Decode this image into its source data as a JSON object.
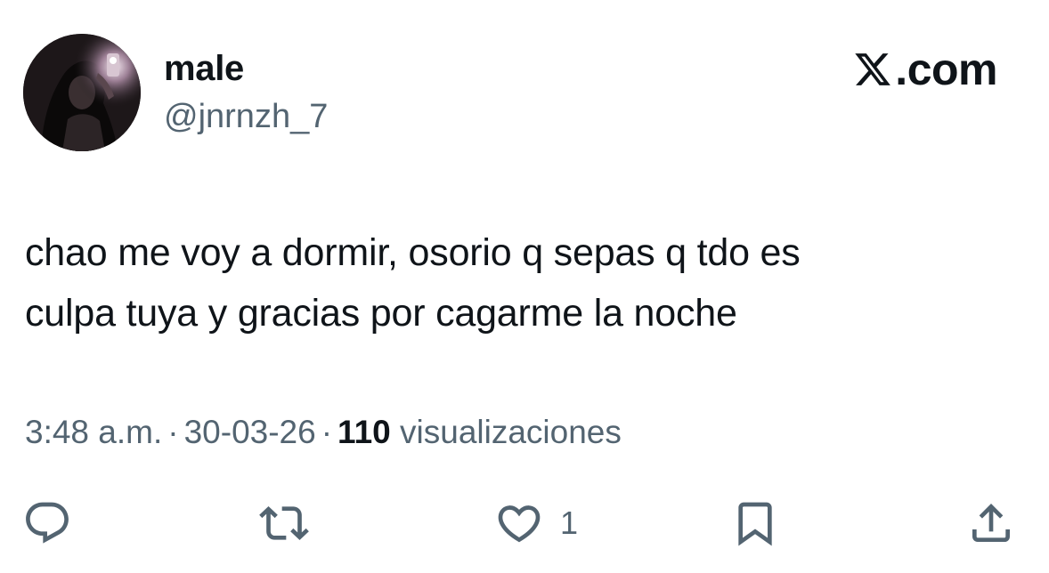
{
  "author": {
    "display_name": "male",
    "handle": "@jnrnzh_7"
  },
  "brand": {
    "label": ".com",
    "icon": "x-logo-icon"
  },
  "tweet": {
    "text_line1": "chao me voy a dormir, osorio q sepas q tdo es",
    "text_line2": "culpa tuya y gracias por cagarme la noche"
  },
  "meta": {
    "time": "3:48 a.m.",
    "separator": "·",
    "date": "30-03-26",
    "views_count": "110",
    "views_label": "visualizaciones"
  },
  "actions": {
    "reply_icon": "reply-icon",
    "retweet_icon": "retweet-icon",
    "like_icon": "heart-icon",
    "like_count": "1",
    "bookmark_icon": "bookmark-icon",
    "share_icon": "share-icon"
  },
  "colors": {
    "text": "#0f1419",
    "secondary": "#536471",
    "background": "#ffffff"
  }
}
